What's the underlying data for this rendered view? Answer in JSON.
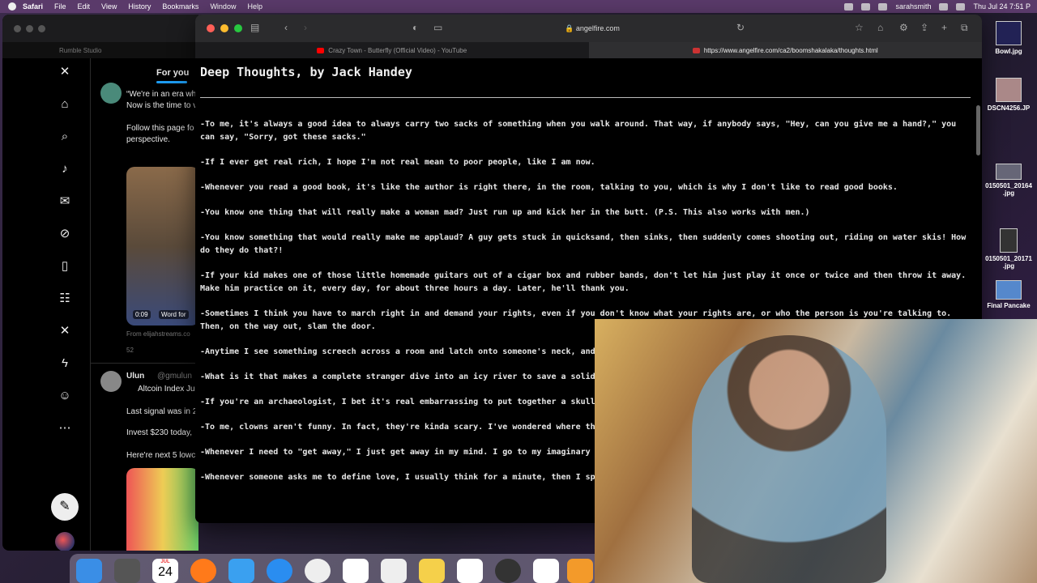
{
  "menubar": {
    "app": "Safari",
    "items": [
      "File",
      "Edit",
      "View",
      "History",
      "Bookmarks",
      "Window",
      "Help"
    ],
    "user": "sarahsmith",
    "clock": "Thu Jul 24  7:51 P"
  },
  "bg_window": {
    "tab": "Rumble Studio",
    "feed_tab": "For you",
    "post1": {
      "line1": "“We're in an era wh",
      "line2": "Now is the time to v",
      "line3": "Follow this page fo",
      "line4": "perspective.",
      "video_time": "0:09",
      "video_caption": "Word for",
      "source": "From elijahstreams.co",
      "replies": "52"
    },
    "post2": {
      "name": "Ulun",
      "handle": "@gmulun",
      "line1": "Altcoin Index Ju",
      "line2": "Last signal was in 2",
      "line3": "Invest $230 today,",
      "line4": "Here're next 5 lowc"
    }
  },
  "browser": {
    "url": "angelfire.com",
    "tabs": [
      {
        "label": "Crazy Town - Butterfly (Official Video) - YouTube",
        "color": "#ff0000"
      },
      {
        "label": "https://www.angelfire.com/ca2/boomshakalaka/thoughts.html",
        "color": "#cc3333"
      }
    ]
  },
  "page": {
    "title": "Deep Thoughts, by Jack Handey",
    "thoughts": [
      "-To me, it's always a good idea to always carry two sacks of something when you walk around. That way, if anybody says, \"Hey, can you give me a hand?,\" you can say, \"Sorry, got these sacks.\"",
      "-If I ever get real rich, I hope I'm not real mean to poor people, like I am now.",
      "-Whenever you read a good book, it's like the author is right there, in the room, talking to you, which is why I don't like to read good books.",
      "-You know one thing that will really make a woman mad? Just run up and kick her in the butt. (P.S. This also works with men.)",
      "-You know something that would really make me applaud? A guy gets stuck in quicksand, then sinks, then suddenly comes shooting out, riding on water skis! How do they do that?!",
      "-If your kid makes one of those little homemade guitars out of a cigar box and rubber bands, don't let him just play it once or twice and then throw it away. Make him practice on it, every day, for about three hours a day. Later, he'll thank you.",
      "-Sometimes I think you have to march right in and demand your rights, even if you don't know what your rights are, or who the person is you're talking to. Then, on the way out, slam the door.",
      "-Anytime I see something screech across a room and latch onto someone's neck, and the g",
      "-What is it that makes a complete stranger dive into an icy river to save a solid-gold bab",
      "-If you're an archaeologist, I bet it's real embarrassing to put together a skull from a bu dried-out potato.",
      "-To me, clowns aren't funny. In fact, they're kinda scary. I've wondered where this star dad.",
      "-Whenever I need to \"get away,\" I just get away in my mind. I go to my imaginary spot, The only bad thing there are the flies. They're terrible!",
      "-Whenever someone asks me to define love, I usually think for a minute, then I spin arou"
    ]
  },
  "desktop_icons": [
    "Bowl.jpg",
    "DSCN4256.JP",
    "0150501_20164 .jpg",
    "0150501_20171 .jpg",
    "Final Pancake"
  ],
  "dock": {
    "calendar_month": "JUL",
    "calendar_day": "24"
  }
}
